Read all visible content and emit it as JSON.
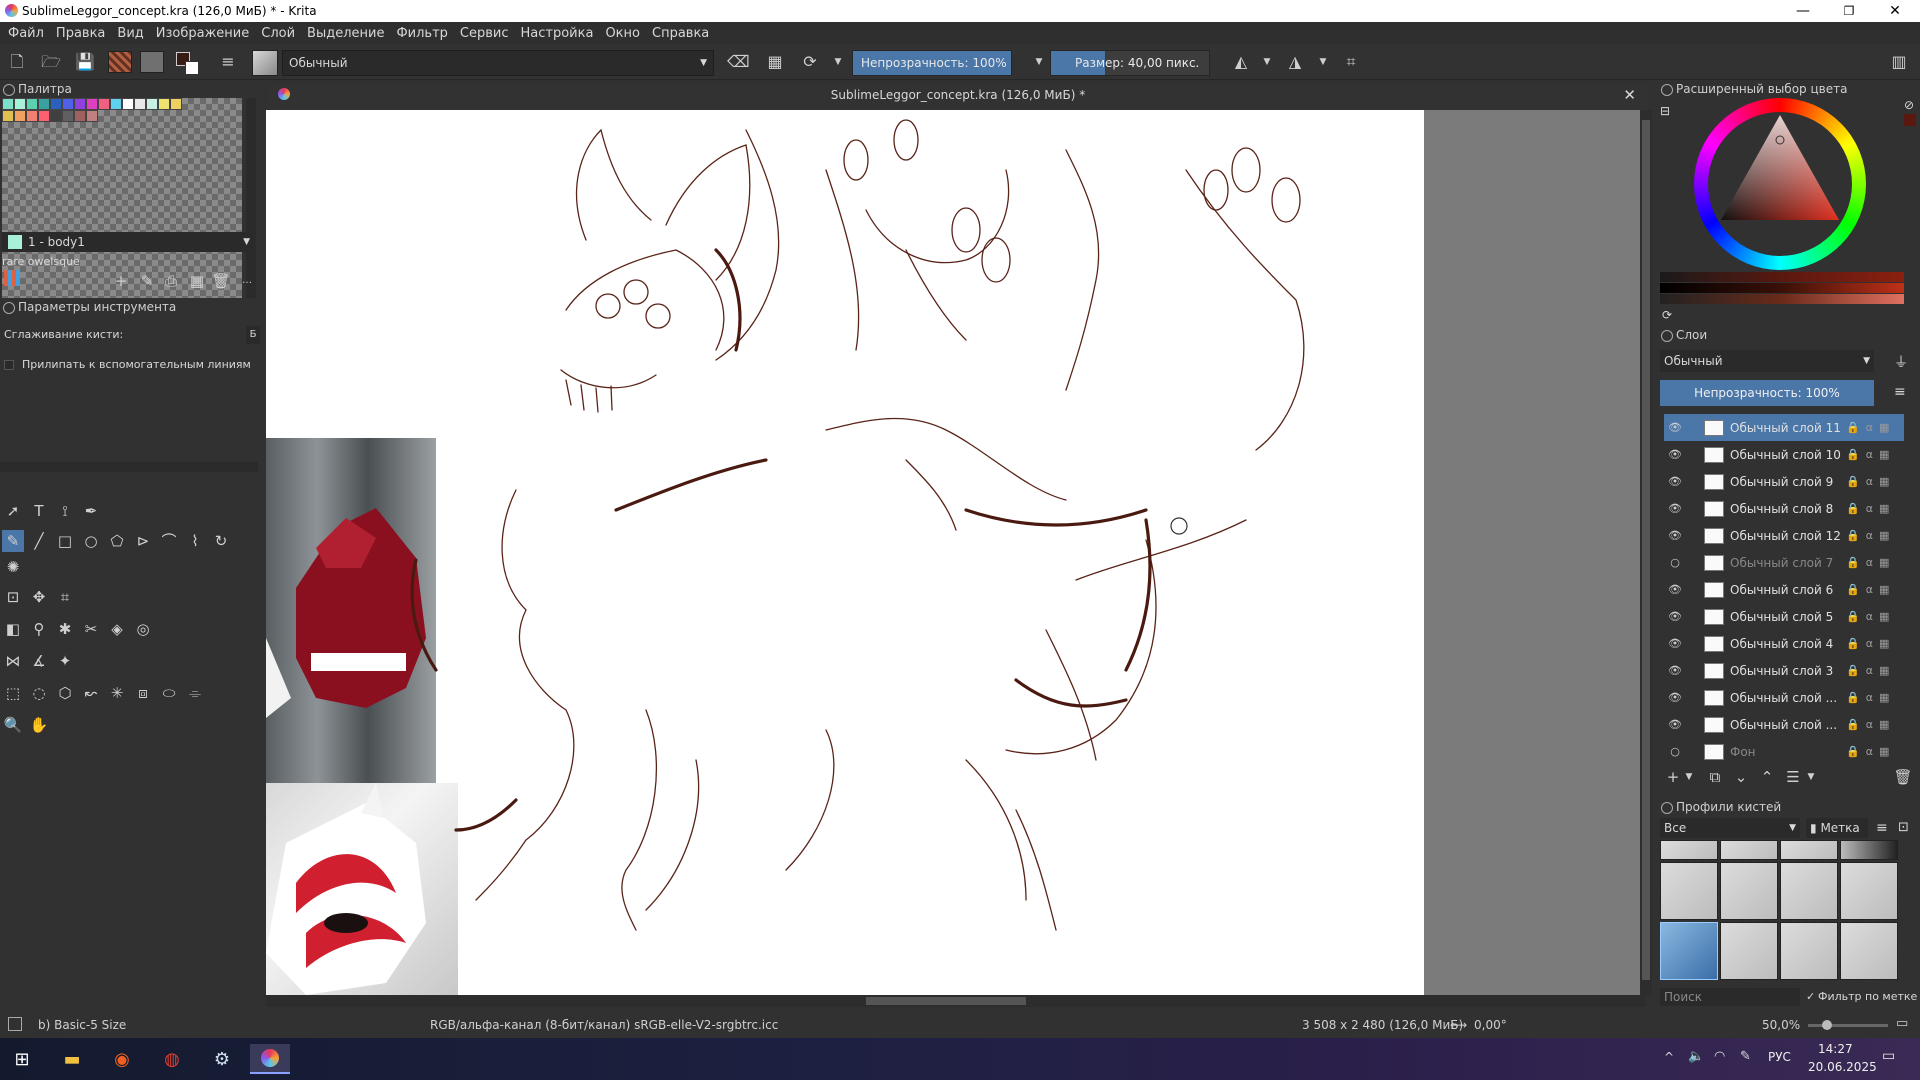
{
  "window": {
    "title": "SublimeLeggor_concept.kra (126,0 МиБ) * - Krita",
    "minimize": "—",
    "maximize": "❐",
    "close": "✕"
  },
  "menu": [
    "Файл",
    "Правка",
    "Вид",
    "Изображение",
    "Слой",
    "Выделение",
    "Фильтр",
    "Сервис",
    "Настройка",
    "Окно",
    "Справка"
  ],
  "toolbar": {
    "blend_mode": "Обычный",
    "opacity_label": "Непрозрачность: 100%",
    "size_label": "Размер: 40,00 пикс."
  },
  "palette": {
    "title": "Палитра",
    "selected_entry": "1 - body1",
    "palette_name": "rare owelsque",
    "swatches": [
      "#7de0c8",
      "#a8f0d8",
      "#5ad0b0",
      "#3aa0a0",
      "#2a60c0",
      "#5060e8",
      "#9040e0",
      "#e040c0",
      "#f06080",
      "#60d0f0",
      "#ffffff",
      "#e8e8e8",
      "#c8f0e0",
      "#f0e070",
      "#f0d060",
      "#e0c050",
      "#f0a060",
      "#f08070",
      "#ff6070",
      "#404040",
      "#606060",
      "#a06060",
      "#c08080"
    ]
  },
  "tool_options": {
    "title": "Параметры инструмента",
    "smoothing_label": "Сглаживание кисти:",
    "snap_label": "Прилипать к вспомогательным линиям"
  },
  "canvas": {
    "tab_title": "SublimeLeggor_concept.kra (126,0 МиБ) *"
  },
  "color_selector": {
    "title": "Расширенный выбор цвета"
  },
  "layers": {
    "title": "Слои",
    "blend_mode": "Обычный",
    "opacity_label": "Непрозрачность:  100%",
    "items": [
      {
        "name": "Обычный слой 11",
        "visible": true,
        "selected": true
      },
      {
        "name": "Обычный слой 10",
        "visible": true,
        "selected": false
      },
      {
        "name": "Обычный слой 9",
        "visible": true,
        "selected": false
      },
      {
        "name": "Обычный слой 8",
        "visible": true,
        "selected": false
      },
      {
        "name": "Обычный слой 12",
        "visible": true,
        "selected": false
      },
      {
        "name": "Обычный слой 7",
        "visible": false,
        "selected": false
      },
      {
        "name": "Обычный слой 6",
        "visible": true,
        "selected": false
      },
      {
        "name": "Обычный слой 5",
        "visible": true,
        "selected": false
      },
      {
        "name": "Обычный слой 4",
        "visible": true,
        "selected": false
      },
      {
        "name": "Обычный слой 3",
        "visible": true,
        "selected": false
      },
      {
        "name": "Обычный слой ...",
        "visible": true,
        "selected": false
      },
      {
        "name": "Обычный слой ...",
        "visible": true,
        "selected": false
      },
      {
        "name": "Фон",
        "visible": false,
        "selected": false
      }
    ]
  },
  "brush_presets": {
    "title": "Профили кистей",
    "filter_value": "Все",
    "tag_button": "Метка",
    "search_placeholder": "Поиск",
    "filter_by_tag": "Фильтр по метке"
  },
  "status": {
    "brush_name": "b) Basic-5 Size",
    "color_space": "RGB/альфа-канал (8-бит/канал)  sRGB-elle-V2-srgbtrc.icc",
    "dimensions": "3 508 x 2 480 (126,0 МиБ)",
    "rotation": "0,00°",
    "zoom": "50,0%"
  },
  "taskbar": {
    "language": "РУС",
    "time": "14:27",
    "date": "20.06.2025"
  },
  "colors": {
    "accent": "#4a76a8",
    "sketch": "#5a2418",
    "panel": "#313131"
  }
}
